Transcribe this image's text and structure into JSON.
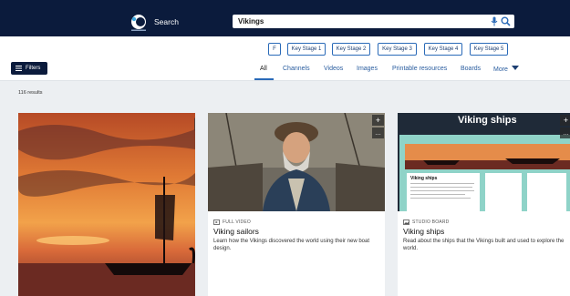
{
  "header": {
    "logo_icon": "discovery-education-logo",
    "search_label": "Search",
    "search_value": "Vikings",
    "mic_icon": "mic-icon",
    "search_icon": "search-icon"
  },
  "key_stages": [
    "F",
    "Key Stage 1",
    "Key Stage 2",
    "Key Stage 3",
    "Key Stage 4",
    "Key Stage 5"
  ],
  "filters_button": "Filters",
  "tabs": [
    "All",
    "Channels",
    "Videos",
    "Images",
    "Printable resources",
    "Boards",
    "More"
  ],
  "active_tab": "All",
  "results_count": "116 results",
  "cards": [
    {
      "type": "image",
      "badge": "",
      "title": "",
      "description": ""
    },
    {
      "type": "video",
      "badge": "FULL VIDEO",
      "title": "Viking sailors",
      "description": "Learn how the Vikings discovered the world using their new boat design."
    },
    {
      "type": "board",
      "badge": "STUDIO BOARD",
      "title": "Viking ships",
      "description": "Read about the ships that the Vikings built and used to explore the world.",
      "thumb_heading": "Viking ships",
      "thumb_subheading": "Viking ships"
    }
  ],
  "colors": {
    "navy": "#0b1b3c",
    "accent": "#2a6ab8",
    "teal": "#8fd3c8"
  }
}
